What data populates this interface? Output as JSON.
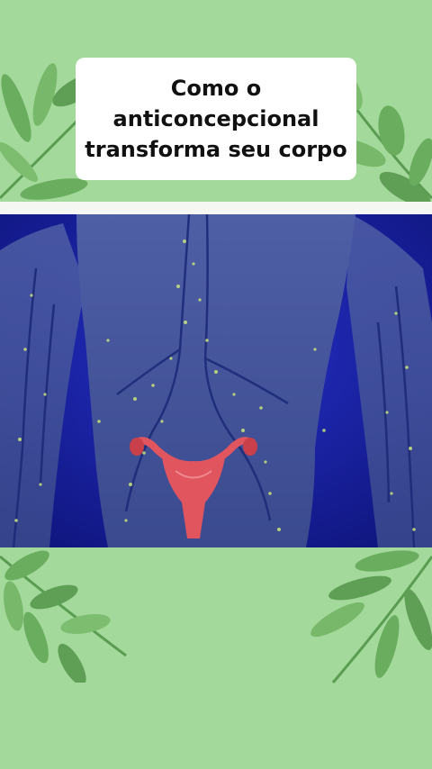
{
  "title": {
    "lines": [
      "Como o",
      "anticoncepcional",
      "transforma seu corpo"
    ]
  },
  "colors": {
    "background": "#a3d99a",
    "leaf": "#5ea65a",
    "title_box": "#ffffff",
    "video_background": "#1a22b8",
    "body_silhouette": "#4a5a9c",
    "uterus": "#e0555e"
  },
  "video": {
    "subject": "anatomy-illustration"
  }
}
